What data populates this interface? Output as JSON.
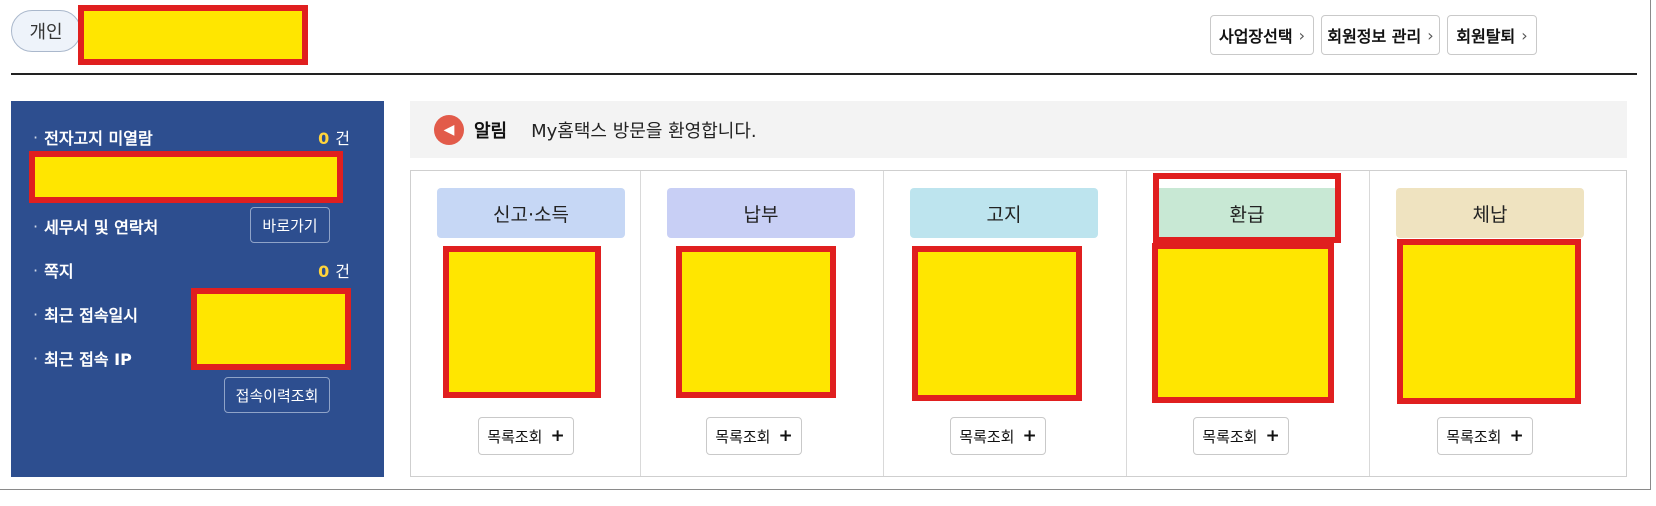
{
  "header": {
    "personal_label": "개인",
    "buttons": [
      {
        "label": "사업장선택",
        "chev": "›"
      },
      {
        "label": "회원정보 관리",
        "chev": "›"
      },
      {
        "label": "회원탈퇴",
        "chev": "›"
      }
    ]
  },
  "left_panel": {
    "rows": [
      {
        "dot": "·",
        "label": "전자고지 미열람"
      },
      {
        "dot": "·",
        "label": "세무서 및 연락처"
      },
      {
        "dot": "·",
        "label": "쪽지"
      },
      {
        "dot": "·",
        "label": "최근 접속일시"
      },
      {
        "dot": "·",
        "label": "최근 접속 IP"
      }
    ],
    "unread_count": "0",
    "note_count": "0",
    "count_unit": "건",
    "shortcut_button": "바로가기",
    "history_button": "접속이력조회"
  },
  "notice": {
    "title": "알림",
    "text": "My홈택스 방문을 환영합니다."
  },
  "categories": [
    {
      "label": "신고·소득",
      "color": "#c6d7f5"
    },
    {
      "label": "납부",
      "color": "#c8cff5"
    },
    {
      "label": "고지",
      "color": "#bde4ee"
    },
    {
      "label": "환급",
      "color": "#c8e8d4"
    },
    {
      "label": "체납",
      "color": "#efe3c0"
    }
  ],
  "more_button": {
    "label": "목록조회",
    "plus": "+"
  },
  "colors": {
    "panel_bg": "#2d4e8f",
    "count_accent": "#ffd43b",
    "redaction_fill": "#ffe600",
    "redaction_border": "#e01f1f"
  }
}
